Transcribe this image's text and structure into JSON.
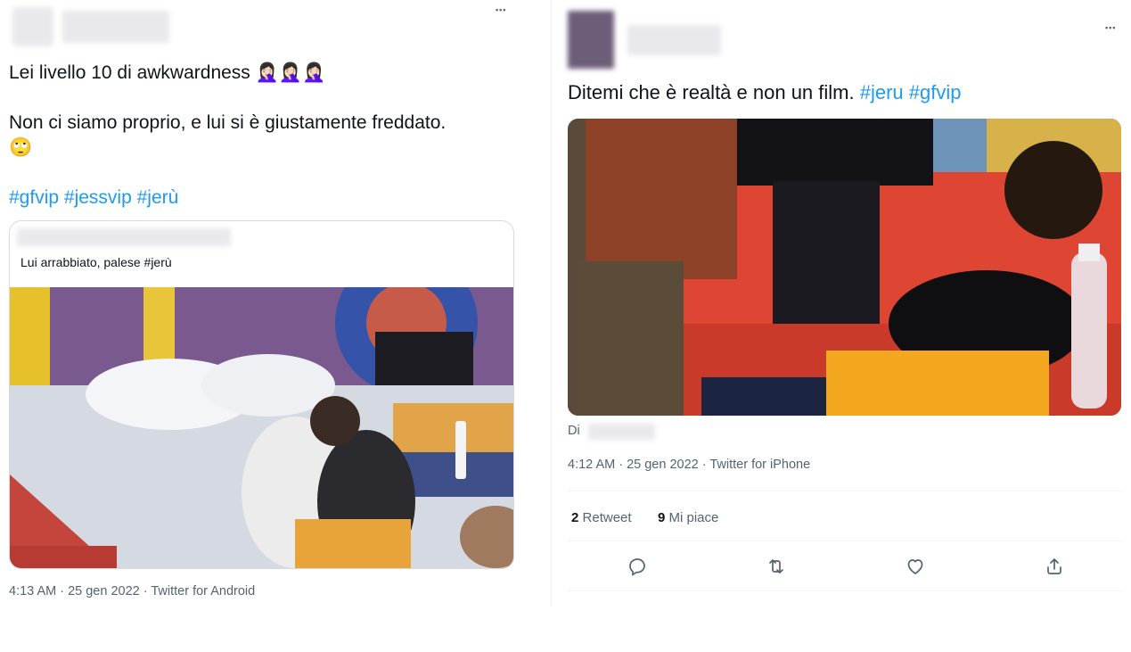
{
  "left_tweet": {
    "text_line1": "Lei livello 10 di awkwardness",
    "emoji_line1": "🤦🏻‍♀️🤦🏻‍♀️🤦🏻‍♀️",
    "text_line2": "Non ci siamo proprio, e lui si è giustamente freddato.",
    "emoji_line3": "🙄",
    "hashtags": [
      "#gfvip",
      "#jessvip",
      "#jerù"
    ],
    "quote": {
      "text": "Lui arrabbiato, palese #jerù"
    },
    "timestamp": "4:13 AM · 25 gen 2022 · Twitter for Android"
  },
  "right_tweet": {
    "text": "Ditemi che è realtà e non un film.",
    "hashtags": [
      "#jeru",
      "#gfvip"
    ],
    "media_caption": "Di",
    "timestamp": "4:12 AM · 25 gen 2022 · Twitter for iPhone",
    "retweets": {
      "count": "2",
      "label": "Retweet"
    },
    "likes": {
      "count": "9",
      "label": "Mi piace"
    }
  },
  "more_glyph": "•••",
  "icons": [
    "reply-icon",
    "retweet-icon",
    "like-icon",
    "share-icon"
  ],
  "colors": {
    "link": "#1d9bf0",
    "secondary_text": "#536471",
    "divider": "#eff3f4"
  }
}
